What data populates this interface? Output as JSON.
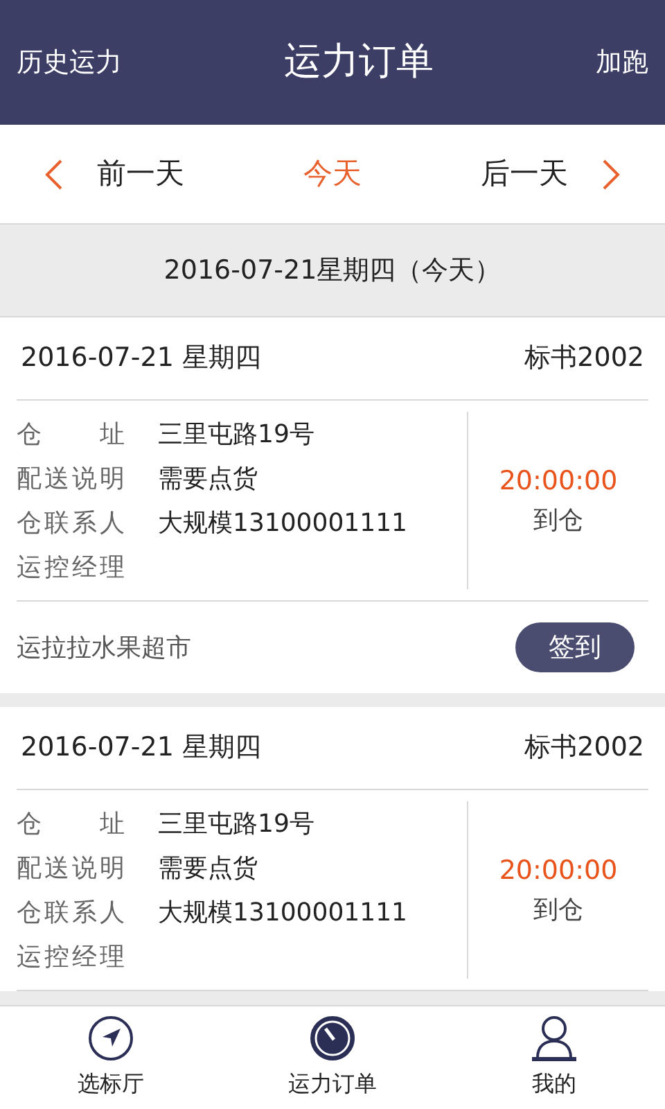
{
  "header": {
    "left": "历史运力",
    "title": "运力订单",
    "right": "加跑"
  },
  "day_nav": [
    {
      "label": "前一天",
      "selected": false
    },
    {
      "label": "今天",
      "selected": true
    },
    {
      "label": "后一天",
      "selected": false
    }
  ],
  "date_banner": "2016-07-21星期四（今天）",
  "orders": [
    {
      "date": "2016-07-21 星期四",
      "tender": "标书2002",
      "fields": [
        {
          "label": "仓 址",
          "value": "三里屯路19号"
        },
        {
          "label": "配送说明",
          "value": "需要点货"
        },
        {
          "label": "仓联系人",
          "value": "大规模13100001111"
        },
        {
          "label": "运控经理"
        }
      ],
      "time": "20:00:00",
      "time_label": "到仓",
      "shop": "运拉拉水果超市",
      "action": "签到"
    },
    {
      "date": "2016-07-21 星期四",
      "tender": "标书2002",
      "fields": [
        {
          "label": "仓 址",
          "value": "三里屯路19号"
        },
        {
          "label": "配送说明",
          "value": "需要点货"
        },
        {
          "label": "仓联系人",
          "value": "大规模13100001111"
        },
        {
          "label": "运控经理"
        }
      ],
      "time": "20:00:00",
      "time_label": "到仓"
    }
  ],
  "tabbar": [
    {
      "kind": "compass",
      "label": "选标厅",
      "selected": false
    },
    {
      "kind": "clock",
      "label": "运力订单",
      "selected": true
    },
    {
      "kind": "person",
      "label": "我的",
      "selected": false
    }
  ]
}
